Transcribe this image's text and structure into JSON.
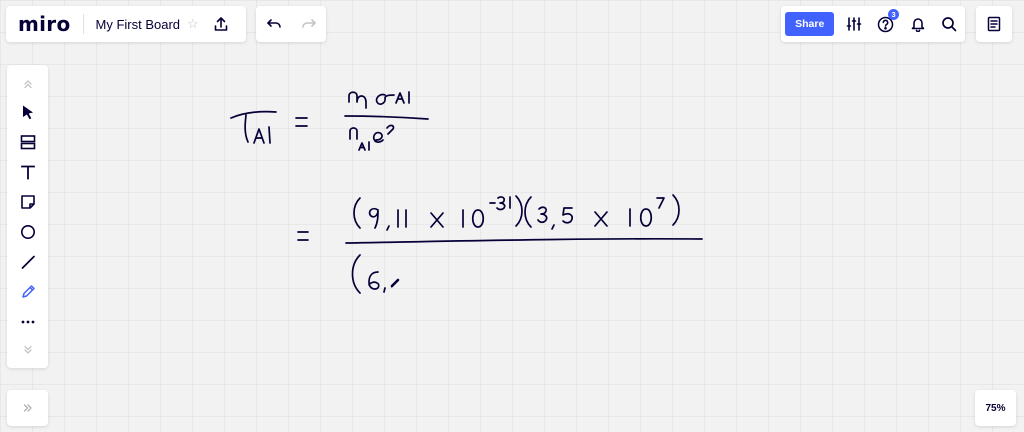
{
  "app": {
    "logo": "miro",
    "board_title": "My First Board"
  },
  "toolbar_top": {
    "share_label": "Share",
    "notification_count": "3"
  },
  "zoom": {
    "level": "75%"
  },
  "icons": {
    "star": "star-icon",
    "upload": "upload-icon",
    "undo": "undo-icon",
    "redo": "redo-icon",
    "settings": "sliders-icon",
    "help": "help-icon",
    "notifications": "bell-icon",
    "search": "search-icon",
    "notes": "notes-icon",
    "tools": [
      "collapse-up-icon",
      "select-icon",
      "frame-icon",
      "text-icon",
      "sticky-note-icon",
      "shape-icon",
      "line-icon",
      "pen-icon",
      "more-icon",
      "collapse-down-icon"
    ],
    "expand": "expand-icon"
  },
  "colors": {
    "accent": "#4262ff",
    "ink": "#050038",
    "pen_active": "#4262ff"
  }
}
